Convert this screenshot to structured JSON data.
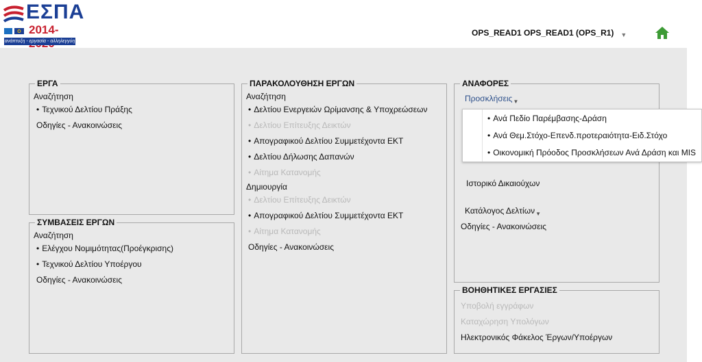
{
  "header": {
    "logo": {
      "title": "ΕΣΠΑ",
      "years": "2014-2020",
      "tagline": "ανάπτυξη - εργασία - αλληλεγγύη"
    },
    "user_label": "OPS_READ1 OPS_READ1 (OPS_R1)",
    "home_icon": "home-icon"
  },
  "erga": {
    "title": "ΕΡΓΑ",
    "search_label": "Αναζήτηση",
    "items": [
      {
        "label": "Τεχνικού Δελτίου Πράξης",
        "enabled": true
      }
    ],
    "guides": "Οδηγίες - Ανακοινώσεις"
  },
  "symvaseis": {
    "title": "ΣΥΜΒΑΣΕΙΣ ΕΡΓΩΝ",
    "search_label": "Αναζήτηση",
    "items": [
      {
        "label": "Ελέγχου Νομιμότητας(Προέγκρισης)",
        "enabled": true
      },
      {
        "label": "Τεχνικού Δελτίου Υποέργου",
        "enabled": true
      }
    ],
    "guides": "Οδηγίες - Ανακοινώσεις"
  },
  "parakolouthisi": {
    "title": "ΠΑΡΑΚΟΛΟΥΘΗΣΗ ΕΡΓΩΝ",
    "search_label": "Αναζήτηση",
    "search_items": [
      {
        "label": "Δελτίου Ενεργειών Ωρίμανσης & Υποχρεώσεων",
        "enabled": true
      },
      {
        "label": "Δελτίου Επίτευξης Δεικτών",
        "enabled": false
      },
      {
        "label": "Απογραφικού Δελτίου Συμμετέχοντα ΕΚΤ",
        "enabled": true
      },
      {
        "label": "Δελτίου Δήλωσης Δαπανών",
        "enabled": true
      },
      {
        "label": "Αίτημα Κατανομής",
        "enabled": false
      }
    ],
    "create_label": "Δημιουργία",
    "create_items": [
      {
        "label": "Δελτίου Επίτευξης Δεικτών",
        "enabled": false
      },
      {
        "label": "Απογραφικού Δελτίου Συμμετέχοντα ΕΚΤ",
        "enabled": true
      },
      {
        "label": "Αίτημα Κατανομής",
        "enabled": false
      }
    ],
    "guides": "Οδηγίες - Ανακοινώσεις"
  },
  "anafores": {
    "title": "ΑΝΑΦΟΡΕΣ",
    "proskliseis": "Προσκλήσεις",
    "dropdown_items": [
      "Ανά Πεδίο Παρέμβασης-Δράση",
      "Ανά Θεμ.Στόχο-Επενδ.προτεραιότητα-Ειδ.Στόχο",
      "Οικονομική Πρόοδος Προσκλήσεων Ανά Δράση και MIS"
    ],
    "istoriko": "Ιστορικό Δικαιούχων",
    "katalogos": "Κατάλογος Δελτίων",
    "guides": "Οδηγίες - Ανακοινώσεις"
  },
  "voithitikes": {
    "title": "ΒΟΗΘΗΤΙΚΕΣ ΕΡΓΑΣΙΕΣ",
    "items": [
      {
        "label": "Υποβολή εγγράφων",
        "enabled": false
      },
      {
        "label": "Καταχώρηση Υπολόγων",
        "enabled": false
      },
      {
        "label": "Ηλεκτρονικός Φάκελος Έργων/Υποέργων",
        "enabled": true
      }
    ]
  },
  "colors": {
    "brand_blue": "#1b3f95",
    "brand_red": "#c8202f",
    "home_green": "#3d9b35",
    "disabled": "#b8b8b8"
  }
}
